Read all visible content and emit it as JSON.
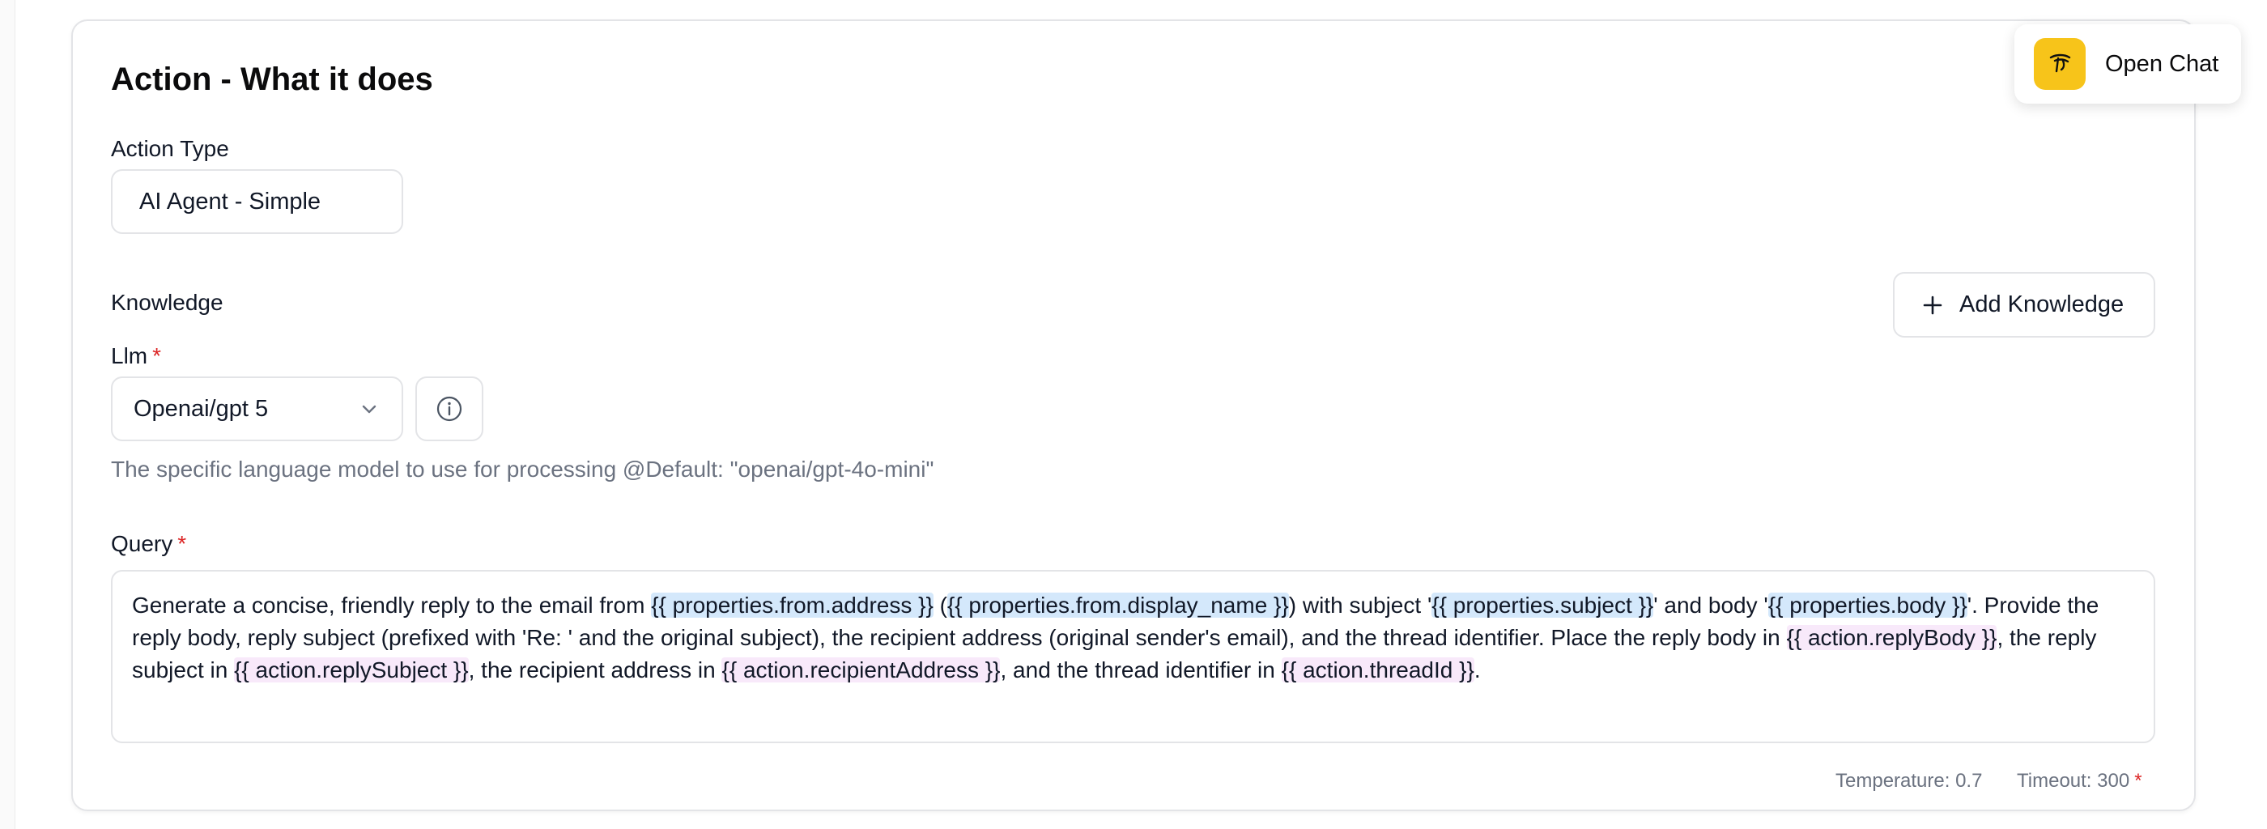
{
  "action_section": {
    "title": "Action - What it does",
    "action_type": {
      "label": "Action Type",
      "value": "AI Agent - Simple"
    }
  },
  "knowledge": {
    "label": "Knowledge",
    "add_button": "Add Knowledge",
    "add_icon": "plus-icon"
  },
  "llm": {
    "label": "Llm",
    "required_mark": "*",
    "selected": "Openai/gpt 5",
    "helper": "The specific language model to use for processing @Default: \"openai/gpt-4o-mini\""
  },
  "query": {
    "label": "Query",
    "required_mark": "*",
    "segments": [
      {
        "type": "text",
        "value": "Generate a concise, friendly reply to the email from "
      },
      {
        "type": "input_var",
        "value": "{{ properties.from.address }}"
      },
      {
        "type": "text",
        "value": " ("
      },
      {
        "type": "input_var",
        "value": "{{ properties.from.display_name }}"
      },
      {
        "type": "text",
        "value": ") with subject '"
      },
      {
        "type": "input_var",
        "value": "{{ properties.subject }}"
      },
      {
        "type": "text",
        "value": "' and body '"
      },
      {
        "type": "input_var",
        "value": "{{ properties.body }}"
      },
      {
        "type": "text",
        "value": "'. Provide the reply body, reply subject (prefixed with 'Re: ' and the original subject), the recipient address (original sender's email), and the thread identifier. Place the reply body in "
      },
      {
        "type": "output_var",
        "value": "{{ action.replyBody }}"
      },
      {
        "type": "text",
        "value": ", the reply subject in "
      },
      {
        "type": "output_var",
        "value": "{{ action.replySubject }}"
      },
      {
        "type": "text",
        "value": ", the recipient address in "
      },
      {
        "type": "output_var",
        "value": "{{ action.recipientAddress }}"
      },
      {
        "type": "text",
        "value": ", and the thread identifier in "
      },
      {
        "type": "output_var",
        "value": "{{ action.threadId }}"
      },
      {
        "type": "text",
        "value": "."
      }
    ]
  },
  "meta": {
    "temperature": "Temperature: 0.7",
    "timeout": "Timeout: 300",
    "timeout_mark": "*"
  },
  "open_chat": {
    "label": "Open Chat",
    "icon": "chat-agent-icon"
  },
  "colors": {
    "input_var_highlight": "#d4e8fb",
    "output_var_highlight": "#f8e9fa",
    "required": "#dc2626",
    "chat_icon_bg": "#f7c41a"
  }
}
